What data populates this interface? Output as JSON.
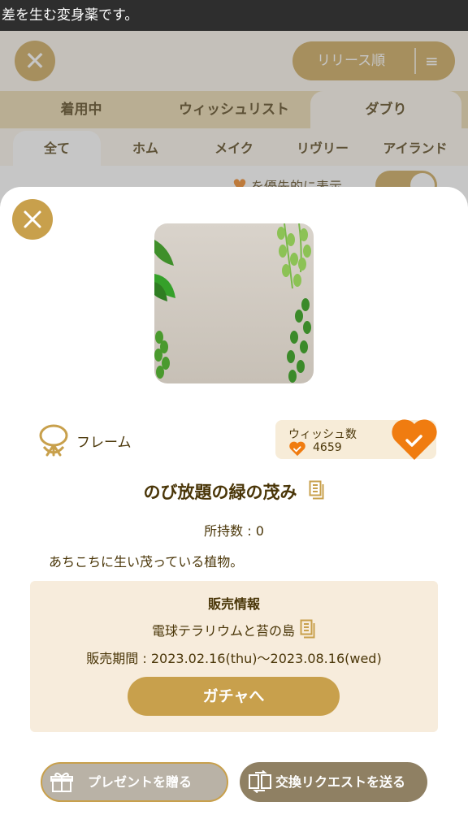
{
  "topbar": {
    "text": "差を生む変身薬です。"
  },
  "header": {
    "sort_label": "リリース順"
  },
  "tabs": [
    {
      "label": "着用中"
    },
    {
      "label": "ウィッシュリスト"
    },
    {
      "label": "ダブり",
      "selected": true
    }
  ],
  "subtabs": [
    {
      "label": "全て",
      "selected": true
    },
    {
      "label": "ホム"
    },
    {
      "label": "メイク"
    },
    {
      "label": "リヴリー"
    },
    {
      "label": "アイランド"
    }
  ],
  "filter": {
    "label": "を優先的に表示",
    "enabled": true
  },
  "item": {
    "category": "フレーム",
    "wish_label": "ウィッシュ数",
    "wish_count": "4659",
    "name": "のび放題の緑の茂み",
    "owned": "所持数 : 0",
    "description": "あちこちに生い茂っている植物。"
  },
  "sale": {
    "title": "販売情報",
    "source": "電球テラリウムと苔の島",
    "period": "販売期間 : 2023.02.16(thu)〜2023.08.16(wed)",
    "gacha_button": "ガチャへ"
  },
  "actions": {
    "present": "プレゼントを贈る",
    "trade": "交換リクエストを送る"
  },
  "colors": {
    "accent_gold": "#c8a04c",
    "wish_orange": "#f07c10",
    "text_brown": "#4a3608"
  }
}
